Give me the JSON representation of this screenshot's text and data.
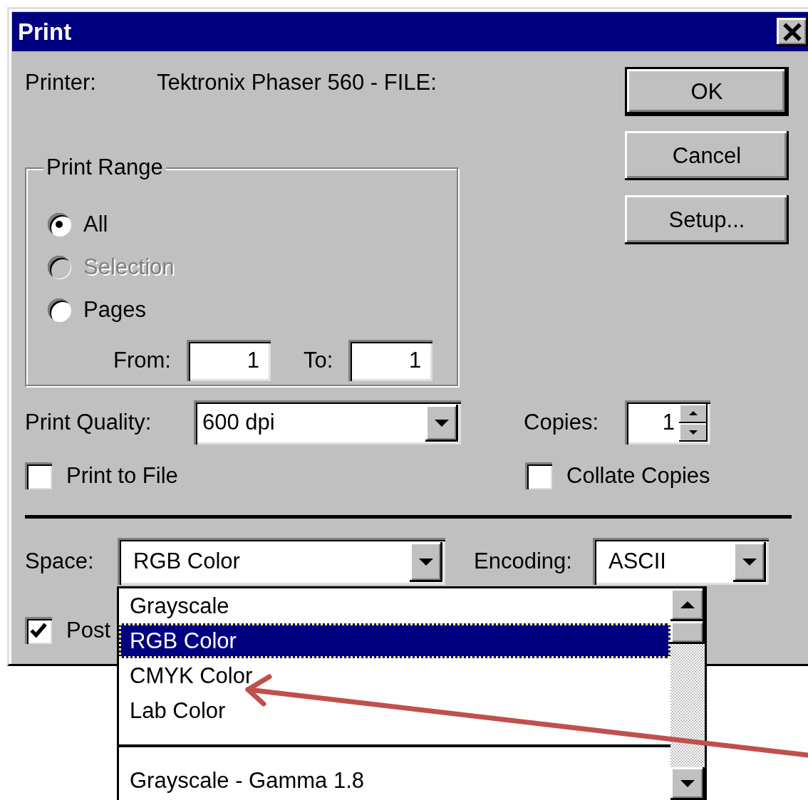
{
  "window": {
    "title": "Print"
  },
  "printer": {
    "label": "Printer:",
    "value": "Tektronix Phaser 560 - FILE:"
  },
  "buttons": [
    {
      "label": "OK",
      "default": true
    },
    {
      "label": "Cancel",
      "default": false
    },
    {
      "label": "Setup...",
      "default": false
    }
  ],
  "print_range": {
    "title": "Print Range",
    "options": [
      {
        "label": "All",
        "selected": true,
        "disabled": false
      },
      {
        "label": "Selection",
        "selected": false,
        "disabled": true
      },
      {
        "label": "Pages",
        "selected": false,
        "disabled": false
      }
    ],
    "from": {
      "label": "From:",
      "value": "1"
    },
    "to": {
      "label": "To:",
      "value": "1"
    }
  },
  "print_quality": {
    "label": "Print Quality:",
    "value": "600 dpi"
  },
  "copies": {
    "label": "Copies:",
    "value": "1"
  },
  "print_to_file": {
    "label": "Print to File",
    "checked": false
  },
  "collate_copies": {
    "label": "Collate Copies",
    "checked": false
  },
  "space": {
    "label": "Space:",
    "value": "RGB Color",
    "expanded": true,
    "items": [
      {
        "kind": "option",
        "label": "Grayscale",
        "selected": false
      },
      {
        "kind": "option",
        "label": "RGB Color",
        "selected": true
      },
      {
        "kind": "option",
        "label": "CMYK Color",
        "selected": false
      },
      {
        "kind": "option",
        "label": "Lab Color",
        "selected": false
      },
      {
        "kind": "separator"
      },
      {
        "kind": "option",
        "label": "Grayscale - Gamma 1.8",
        "selected": false
      }
    ]
  },
  "encoding": {
    "label": "Encoding:",
    "value": "ASCII"
  },
  "postscript": {
    "label": "Post",
    "checked": true
  }
}
